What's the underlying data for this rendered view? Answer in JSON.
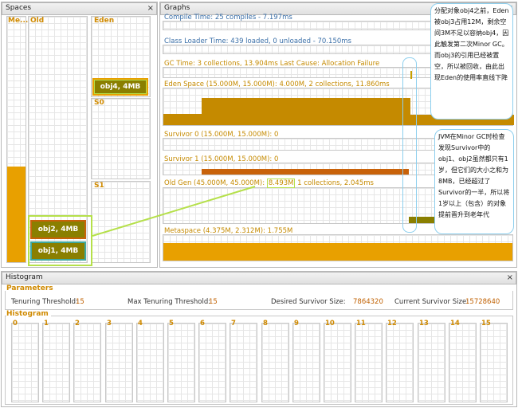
{
  "spaces": {
    "title": "Spaces",
    "close": "×",
    "columns": {
      "metaspace": "Me...",
      "old": "Old",
      "eden": "Eden",
      "s0": "S0",
      "s1": "S1"
    },
    "objects": {
      "obj4": "obj4, 4MB",
      "obj2": "obj2, 4MB",
      "obj1": "obj1, 4MB"
    },
    "metaspace_fill_fraction": 0.38
  },
  "graphs": {
    "title": "Graphs",
    "close": "×",
    "rows": {
      "compile": "Compile Time: 25 compiles - 7.197ms",
      "classloader": "Class Loader Time: 439 loaded, 0 unloaded - 70.150ms",
      "gc": "GC Time: 3 collections, 13.904ms Last Cause: Allocation Failure",
      "eden": "Eden Space (15.000M, 15.000M): 4.000M, 2 collections, 11.860ms",
      "survivor0": "Survivor 0 (15.000M, 15.000M): 0",
      "survivor1": "Survivor 1 (15.000M, 15.000M): 0",
      "oldgen_prefix": "Old Gen (45.000M, 45.000M): ",
      "oldgen_highlight": "8.493M",
      "oldgen_suffix": " 1 collections, 2.045ms",
      "metaspace": "Metaspace (4.375M, 2.312M): 1.755M"
    }
  },
  "annotations": {
    "callout1": "分配对象obj4之前，Eden被obj3占用12M，剩余空间3M不足以容纳obj4，因此触发第二次Minor GC。而obj3的引用已经被置空，所以被回收，由此出现Eden的使用率直线下降",
    "callout2": "JVM在Minor GC时检查发现Survivor中的obj1、obj2虽然都只有1岁，但它们的大小之和为8MB，已经超过了Survivor的一半，所以将1岁以上（包含）的对象提前晋升到老年代"
  },
  "histogram": {
    "title": "Histogram",
    "close": "×",
    "parameters_label": "Parameters",
    "tenuring_threshold_label": "Tenuring Threshold:",
    "tenuring_threshold_value": "15",
    "max_tenuring_threshold_label": "Max Tenuring Threshold:",
    "max_tenuring_threshold_value": "15",
    "desired_survivor_label": "Desired Survivor Size:",
    "desired_survivor_value": "7864320",
    "current_survivor_label": "Current Survivor Size:",
    "current_survivor_value": "15728640",
    "histogram_label": "Histogram",
    "bins": [
      "0",
      "1",
      "2",
      "3",
      "4",
      "5",
      "6",
      "7",
      "8",
      "9",
      "10",
      "11",
      "12",
      "13",
      "14",
      "15"
    ]
  },
  "colors": {
    "fill_orange": "#e8a000",
    "fill_dark_orange": "#c8620a",
    "fill_olive": "#8a7f00",
    "highlight_green": "#b5e04a",
    "callout_border": "#8dcfee"
  }
}
